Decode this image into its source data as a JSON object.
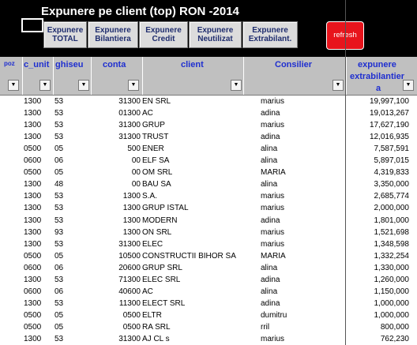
{
  "title": "Expunere pe client (top) RON -2014",
  "buttons": [
    {
      "line1": "Expunere",
      "line2": "TOTAL"
    },
    {
      "line1": "Expunere",
      "line2": "Bilantiera"
    },
    {
      "line1": "Expunere",
      "line2": "Credit"
    },
    {
      "line1": "Expunere",
      "line2": "Neutilizat"
    },
    {
      "line1": "Expunere",
      "line2": "Extrabilant."
    }
  ],
  "refresh_label": "refresh",
  "columns": {
    "poz": "poz",
    "c_unit": "c_unit",
    "ghiseu": "ghiseu",
    "conta": "conta",
    "client": "client",
    "consilier": "Consilier",
    "exp_line1": "expunere",
    "exp_line2": "extrabilantier",
    "exp_line3": "a"
  },
  "filter_icon": "dropdown-arrow",
  "rows": [
    {
      "c_unit": "1300",
      "ghiseu": "53",
      "conta": "31300",
      "client": "EN       SRL",
      "consilier": "marius",
      "exp": "19,997,100"
    },
    {
      "c_unit": "1300",
      "ghiseu": "53",
      "conta": "01300",
      "client": "AC",
      "consilier": "adina",
      "exp": "19,013,267"
    },
    {
      "c_unit": "1300",
      "ghiseu": "53",
      "conta": "31300",
      "client": "GRUP",
      "consilier": "marius",
      "exp": "17,627,190"
    },
    {
      "c_unit": "1300",
      "ghiseu": "53",
      "conta": "31300",
      "client": "TRUST",
      "consilier": "adina",
      "exp": "12,016,935"
    },
    {
      "c_unit": "0500",
      "ghiseu": "05",
      "conta": "500",
      "client": "ENER",
      "consilier": "alina",
      "exp": "7,587,591"
    },
    {
      "c_unit": "0600",
      "ghiseu": "06",
      "conta": "00",
      "client": "ELF SA",
      "consilier": "alina",
      "exp": "5,897,015"
    },
    {
      "c_unit": "0500",
      "ghiseu": "05",
      "conta": "00",
      "client": "OM SRL",
      "consilier": "MARIA",
      "exp": "4,319,833"
    },
    {
      "c_unit": "1300",
      "ghiseu": "48",
      "conta": "00",
      "client": "BAU SA",
      "consilier": "alina",
      "exp": "3,350,000"
    },
    {
      "c_unit": "1300",
      "ghiseu": "53",
      "conta": "1300",
      "client": "S.A.",
      "consilier": "marius",
      "exp": "2,685,774"
    },
    {
      "c_unit": "1300",
      "ghiseu": "53",
      "conta": "1300",
      "client": "GRUP          ISTAL",
      "consilier": "marius",
      "exp": "2,000,000"
    },
    {
      "c_unit": "1300",
      "ghiseu": "53",
      "conta": "1300",
      "client": "MODERN",
      "consilier": "adina",
      "exp": "1,801,000"
    },
    {
      "c_unit": "1300",
      "ghiseu": "93",
      "conta": "1300",
      "client": "ON SRL",
      "consilier": "marius",
      "exp": "1,521,698"
    },
    {
      "c_unit": "1300",
      "ghiseu": "53",
      "conta": "31300",
      "client": "ELEC",
      "consilier": "marius",
      "exp": "1,348,598"
    },
    {
      "c_unit": "0500",
      "ghiseu": "05",
      "conta": "10500",
      "client": "CONSTRUCTII BIHOR SA",
      "consilier": "MARIA",
      "exp": "1,332,254"
    },
    {
      "c_unit": "0600",
      "ghiseu": "06",
      "conta": "20600",
      "client": "GRUP SRL",
      "consilier": "alina",
      "exp": "1,330,000"
    },
    {
      "c_unit": "1300",
      "ghiseu": "53",
      "conta": "71300",
      "client": "ELEC           SRL",
      "consilier": "adina",
      "exp": "1,260,000"
    },
    {
      "c_unit": "0600",
      "ghiseu": "06",
      "conta": "40600",
      "client": "AC",
      "consilier": "alina",
      "exp": "1,150,000"
    },
    {
      "c_unit": "1300",
      "ghiseu": "53",
      "conta": "11300",
      "client": "ELECT           SRL",
      "consilier": "adina",
      "exp": "1,000,000"
    },
    {
      "c_unit": "0500",
      "ghiseu": "05",
      "conta": "0500",
      "client": "ELTR",
      "consilier": "dumitru",
      "exp": "1,000,000"
    },
    {
      "c_unit": "0500",
      "ghiseu": "05",
      "conta": "0500",
      "client": "RA SRL",
      "consilier": "rril",
      "exp": "800,000"
    },
    {
      "c_unit": "1300",
      "ghiseu": "53",
      "conta": "31300",
      "client": "AJ CL s",
      "consilier": "marius",
      "exp": "762,230"
    }
  ]
}
